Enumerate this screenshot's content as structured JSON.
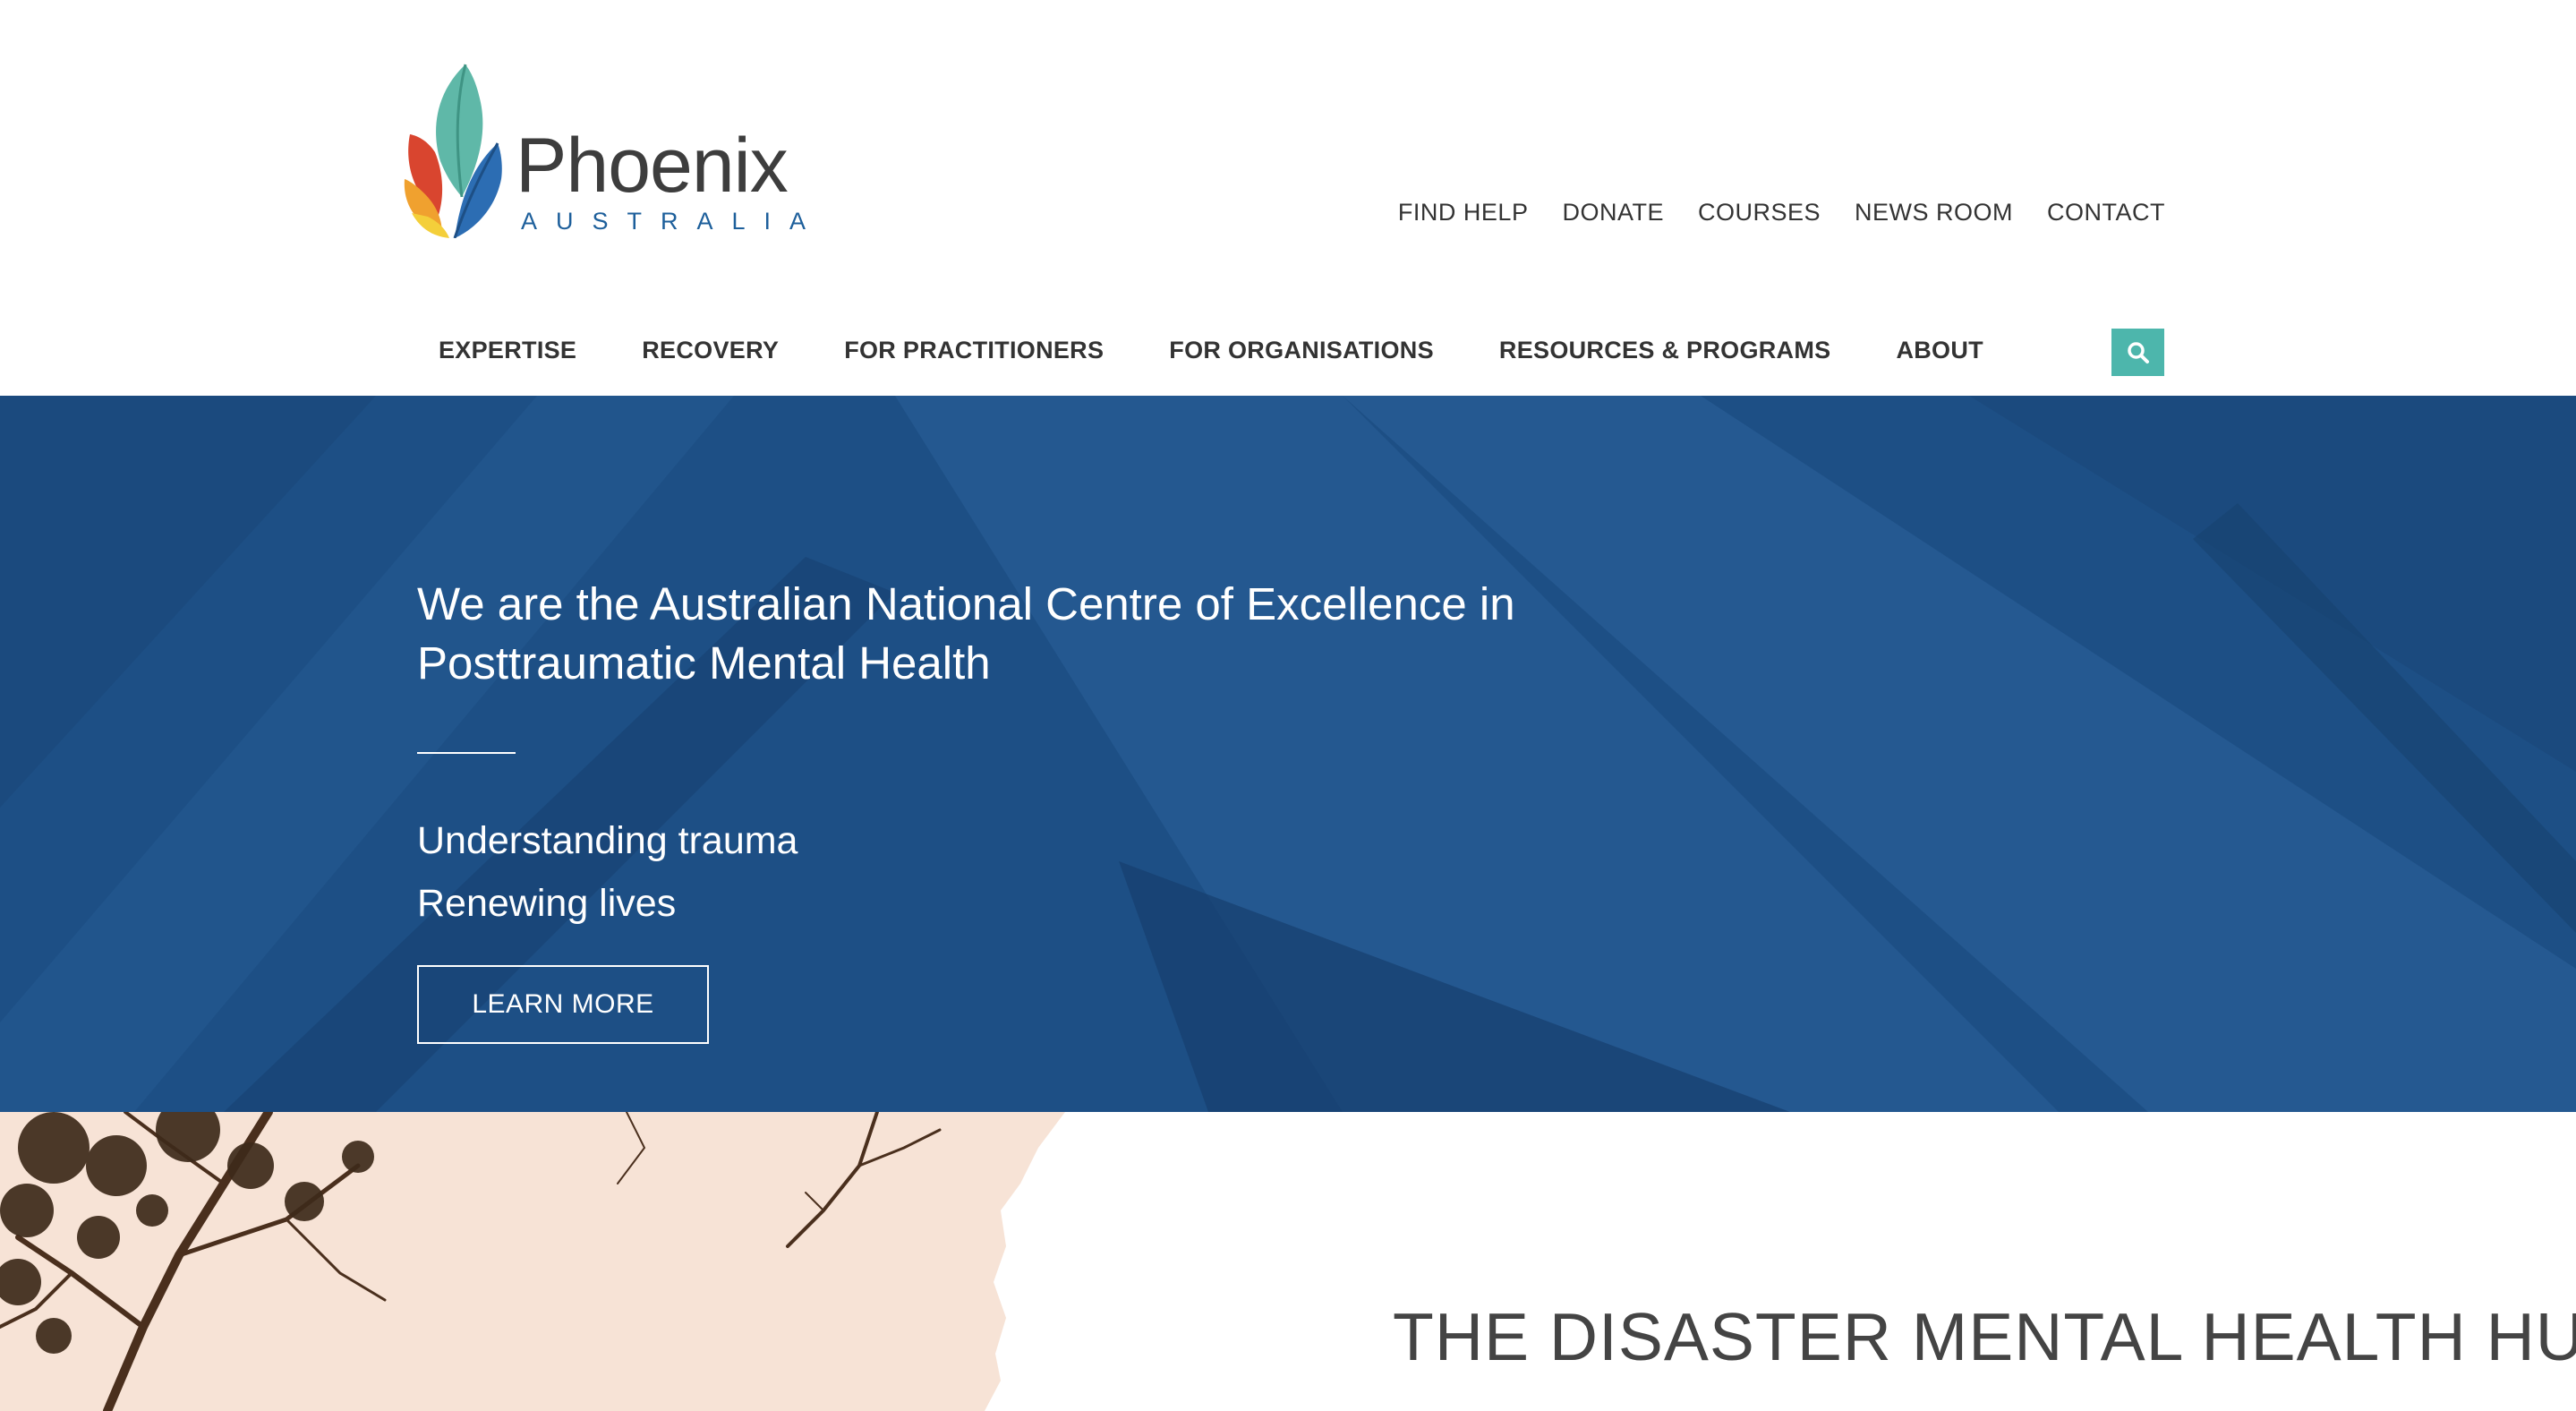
{
  "brand": {
    "name": "Phoenix",
    "subtitle": "AUSTRALIA"
  },
  "utility_nav": [
    {
      "label": "FIND HELP"
    },
    {
      "label": "DONATE"
    },
    {
      "label": "COURSES"
    },
    {
      "label": "NEWS ROOM"
    },
    {
      "label": "CONTACT"
    }
  ],
  "main_nav": [
    {
      "label": "EXPERTISE"
    },
    {
      "label": "RECOVERY"
    },
    {
      "label": "FOR PRACTITIONERS"
    },
    {
      "label": "FOR ORGANISATIONS"
    },
    {
      "label": "RESOURCES & PROGRAMS"
    },
    {
      "label": "ABOUT"
    }
  ],
  "search": {
    "icon": "search-icon"
  },
  "hero": {
    "title": "We are the Australian National Centre of Excellence in Posttraumatic Mental Health",
    "tagline_1": "Understanding trauma",
    "tagline_2": "Renewing lives",
    "cta_label": "LEARN MORE"
  },
  "section": {
    "title": "THE DISASTER MENTAL HEALTH HUB"
  },
  "colors": {
    "hero_blue": "#1d4f85",
    "accent_teal": "#4db6ac",
    "brand_blue": "#1d5f9b",
    "peach": "#f7e3d6"
  }
}
